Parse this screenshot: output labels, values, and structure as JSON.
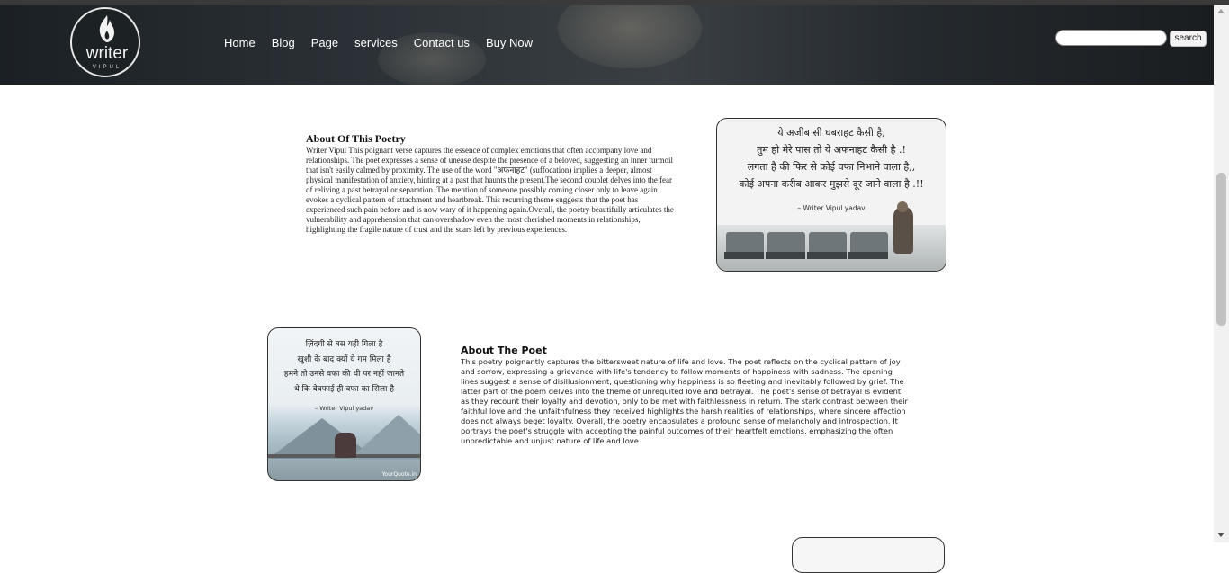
{
  "header": {
    "logo": {
      "word": "writer",
      "sub": "VIPUL"
    },
    "nav": [
      "Home",
      "Blog",
      "Page",
      "services",
      "Contact us",
      "Buy Now"
    ],
    "search": {
      "value": "",
      "button_label": "search"
    }
  },
  "section1": {
    "title": "About Of This Poetry",
    "body": "Writer Vipul This poignant verse captures the essence of complex emotions that often accompany love and relationships. The poet expresses a sense of unease despite the presence of a beloved, suggesting an inner turmoil that isn't easily calmed by proximity. The use of the word \"अफनाहट\" (suffocation) implies a deeper, almost physical manifestation of anxiety, hinting at a past that haunts the present.The second couplet delves into the fear of reliving a past betrayal or separation. The mention of someone possibly coming closer only to leave again evokes a cyclical pattern of attachment and heartbreak. This recurring theme suggests that the poet has experienced such pain before and is now wary of it happening again.Overall, the poetry beautifully articulates the vulnerability and apprehension that can overshadow even the most cherished moments in relationships, highlighting the fragile nature of trust and the scars left by previous experiences.",
    "card": {
      "lines": [
        "ये अजीब सी घबराहट कैसी है,",
        "तुम हो मेरे पास तो ये अफनाहट कैसी है .!",
        "लगता है की फिर से कोई वफा निभाने वाला है,,",
        "कोई अपना करीब आकर मुझसे दूर जाने वाला है .!!"
      ],
      "author": "– Writer Vipul yadav"
    }
  },
  "section2": {
    "title": "About The Poet",
    "body": "This poetry poignantly captures the bittersweet nature of life and love. The poet reflects on the cyclical pattern of joy and sorrow, expressing a grievance with life's tendency to follow moments of happiness with sadness. The opening lines suggest a sense of disillusionment, questioning why happiness is so fleeting and inevitably followed by grief. The latter part of the poem delves into the theme of unrequited love and betrayal. The poet's sense of betrayal is evident as they recount their loyalty and devotion, only to be met with faithlessness in return. The stark contrast between their faithful love and the unfaithfulness they received highlights the harsh realities of relationships, where sincere affection does not always beget loyalty. Overall, the poetry encapsulates a profound sense of melancholy and introspection. It portrays the poet's struggle with accepting the painful outcomes of their heartfelt emotions, emphasizing the often unpredictable and unjust nature of life and love.",
    "card": {
      "lines": [
        "ज़िंदगी से बस यही गिला है",
        "खुशी के बाद क्यों ये गम मिला है",
        "हमने तो उनसे वफा की थी पर नहीं जानते",
        "थे कि बेवफाई ही वफा का सिला है"
      ],
      "author": "– Writer Vipul yadav",
      "brand": "YourQuote.in"
    }
  },
  "colors": {
    "header_bg": "#2b3136",
    "nav_text": "#ffffff",
    "page_bg": "#ffffff"
  }
}
